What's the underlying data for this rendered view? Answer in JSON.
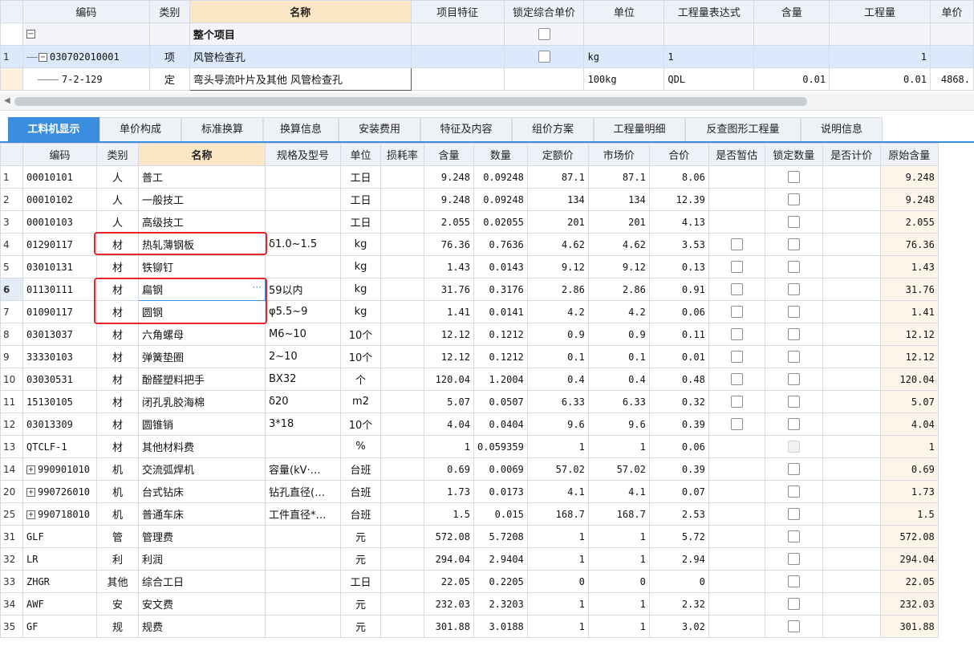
{
  "top": {
    "headers": [
      "编码",
      "类别",
      "名称",
      "项目特征",
      "锁定综合单价",
      "单位",
      "工程量表达式",
      "含量",
      "工程量",
      "单价"
    ],
    "rows": [
      {
        "idx": "",
        "tree": "−",
        "code": "",
        "type": "",
        "name": "整个项目",
        "unit": "",
        "expr": "",
        "content": "",
        "qty": "",
        "price": ""
      },
      {
        "idx": "1",
        "tree": "−",
        "code": "030702010001",
        "type": "项",
        "name": "风管检查孔",
        "unit": "kg",
        "expr": "1",
        "content": "",
        "qty": "1",
        "price": ""
      },
      {
        "idx": "",
        "tree": "",
        "code": "7-2-129",
        "type": "定",
        "name": "弯头导流叶片及其他 风管检查孔",
        "unit": "100kg",
        "expr": "QDL",
        "content": "0.01",
        "qty": "0.01",
        "price": "4868."
      }
    ]
  },
  "tabs": [
    "工料机显示",
    "单价构成",
    "标准换算",
    "换算信息",
    "安装费用",
    "特征及内容",
    "组价方案",
    "工程量明细",
    "反查图形工程量",
    "说明信息"
  ],
  "bottom": {
    "headers": [
      "编码",
      "类别",
      "名称",
      "规格及型号",
      "单位",
      "损耗率",
      "含量",
      "数量",
      "定额价",
      "市场价",
      "合价",
      "是否暂估",
      "锁定数量",
      "是否计价",
      "原始含量"
    ],
    "rows": [
      {
        "idx": "1",
        "tree": "",
        "code": "00010101",
        "type": "人",
        "name": "普工",
        "spec": "",
        "unit": "工日",
        "loss": "",
        "content": "9.248",
        "qty": "0.09248",
        "quota": "87.1",
        "market": "87.1",
        "total": "8.06",
        "est": false,
        "lock": true,
        "orig": "9.248"
      },
      {
        "idx": "2",
        "tree": "",
        "code": "00010102",
        "type": "人",
        "name": "一般技工",
        "spec": "",
        "unit": "工日",
        "loss": "",
        "content": "9.248",
        "qty": "0.09248",
        "quota": "134",
        "market": "134",
        "total": "12.39",
        "est": false,
        "lock": true,
        "orig": "9.248"
      },
      {
        "idx": "3",
        "tree": "",
        "code": "00010103",
        "type": "人",
        "name": "高级技工",
        "spec": "",
        "unit": "工日",
        "loss": "",
        "content": "2.055",
        "qty": "0.02055",
        "quota": "201",
        "market": "201",
        "total": "4.13",
        "est": false,
        "lock": true,
        "orig": "2.055"
      },
      {
        "idx": "4",
        "tree": "",
        "code": "01290117",
        "type": "材",
        "name": "热轧薄钢板",
        "spec": "δ1.0~1.5",
        "unit": "kg",
        "loss": "",
        "content": "76.36",
        "qty": "0.7636",
        "quota": "4.62",
        "market": "4.62",
        "total": "3.53",
        "est": true,
        "lock": true,
        "orig": "76.36"
      },
      {
        "idx": "5",
        "tree": "",
        "code": "03010131",
        "type": "材",
        "name": "铁铆钉",
        "spec": "",
        "unit": "kg",
        "loss": "",
        "content": "1.43",
        "qty": "0.0143",
        "quota": "9.12",
        "market": "9.12",
        "total": "0.13",
        "est": true,
        "lock": true,
        "orig": "1.43"
      },
      {
        "idx": "6",
        "tree": "",
        "code": "01130111",
        "type": "材",
        "name": "扁钢",
        "spec": "59以内",
        "unit": "kg",
        "loss": "",
        "content": "31.76",
        "qty": "0.3176",
        "quota": "2.86",
        "market": "2.86",
        "total": "0.91",
        "est": true,
        "lock": true,
        "orig": "31.76"
      },
      {
        "idx": "7",
        "tree": "",
        "code": "01090117",
        "type": "材",
        "name": "圆钢",
        "spec": "φ5.5~9",
        "unit": "kg",
        "loss": "",
        "content": "1.41",
        "qty": "0.0141",
        "quota": "4.2",
        "market": "4.2",
        "total": "0.06",
        "est": true,
        "lock": true,
        "orig": "1.41"
      },
      {
        "idx": "8",
        "tree": "",
        "code": "03013037",
        "type": "材",
        "name": "六角螺母",
        "spec": "M6~10",
        "unit": "10个",
        "loss": "",
        "content": "12.12",
        "qty": "0.1212",
        "quota": "0.9",
        "market": "0.9",
        "total": "0.11",
        "est": true,
        "lock": true,
        "orig": "12.12"
      },
      {
        "idx": "9",
        "tree": "",
        "code": "33330103",
        "type": "材",
        "name": "弹簧垫圈",
        "spec": "2~10",
        "unit": "10个",
        "loss": "",
        "content": "12.12",
        "qty": "0.1212",
        "quota": "0.1",
        "market": "0.1",
        "total": "0.01",
        "est": true,
        "lock": true,
        "orig": "12.12"
      },
      {
        "idx": "10",
        "tree": "",
        "code": "03030531",
        "type": "材",
        "name": "酚醛塑料把手",
        "spec": "BX32",
        "unit": "个",
        "loss": "",
        "content": "120.04",
        "qty": "1.2004",
        "quota": "0.4",
        "market": "0.4",
        "total": "0.48",
        "est": true,
        "lock": true,
        "orig": "120.04"
      },
      {
        "idx": "11",
        "tree": "",
        "code": "15130105",
        "type": "材",
        "name": "闭孔乳胶海棉",
        "spec": "δ20",
        "unit": "m2",
        "loss": "",
        "content": "5.07",
        "qty": "0.0507",
        "quota": "6.33",
        "market": "6.33",
        "total": "0.32",
        "est": true,
        "lock": true,
        "orig": "5.07"
      },
      {
        "idx": "12",
        "tree": "",
        "code": "03013309",
        "type": "材",
        "name": "圆锥销",
        "spec": "3*18",
        "unit": "10个",
        "loss": "",
        "content": "4.04",
        "qty": "0.0404",
        "quota": "9.6",
        "market": "9.6",
        "total": "0.39",
        "est": true,
        "lock": true,
        "orig": "4.04"
      },
      {
        "idx": "13",
        "tree": "",
        "code": "QTCLF-1",
        "type": "材",
        "name": "其他材料费",
        "spec": "",
        "unit": "%",
        "loss": "",
        "content": "1",
        "qty": "0.059359",
        "quota": "1",
        "market": "1",
        "total": "0.06",
        "est": false,
        "lock": "disabled",
        "orig": "1"
      },
      {
        "idx": "14",
        "tree": "+",
        "code": "990901010",
        "type": "机",
        "name": "交流弧焊机",
        "spec": "容量(kV·…",
        "unit": "台班",
        "loss": "",
        "content": "0.69",
        "qty": "0.0069",
        "quota": "57.02",
        "market": "57.02",
        "total": "0.39",
        "est": false,
        "lock": true,
        "orig": "0.69"
      },
      {
        "idx": "20",
        "tree": "+",
        "code": "990726010",
        "type": "机",
        "name": "台式钻床",
        "spec": "钻孔直径(…",
        "unit": "台班",
        "loss": "",
        "content": "1.73",
        "qty": "0.0173",
        "quota": "4.1",
        "market": "4.1",
        "total": "0.07",
        "est": false,
        "lock": true,
        "orig": "1.73"
      },
      {
        "idx": "25",
        "tree": "+",
        "code": "990718010",
        "type": "机",
        "name": "普通车床",
        "spec": "工件直径*…",
        "unit": "台班",
        "loss": "",
        "content": "1.5",
        "qty": "0.015",
        "quota": "168.7",
        "market": "168.7",
        "total": "2.53",
        "est": false,
        "lock": true,
        "orig": "1.5"
      },
      {
        "idx": "31",
        "tree": "",
        "code": "GLF",
        "type": "管",
        "name": "管理费",
        "spec": "",
        "unit": "元",
        "loss": "",
        "content": "572.08",
        "qty": "5.7208",
        "quota": "1",
        "market": "1",
        "total": "5.72",
        "est": false,
        "lock": true,
        "orig": "572.08"
      },
      {
        "idx": "32",
        "tree": "",
        "code": "LR",
        "type": "利",
        "name": "利润",
        "spec": "",
        "unit": "元",
        "loss": "",
        "content": "294.04",
        "qty": "2.9404",
        "quota": "1",
        "market": "1",
        "total": "2.94",
        "est": false,
        "lock": true,
        "orig": "294.04"
      },
      {
        "idx": "33",
        "tree": "",
        "code": "ZHGR",
        "type": "其他",
        "name": "综合工日",
        "spec": "",
        "unit": "工日",
        "loss": "",
        "content": "22.05",
        "qty": "0.2205",
        "quota": "0",
        "market": "0",
        "total": "0",
        "est": false,
        "lock": true,
        "orig": "22.05"
      },
      {
        "idx": "34",
        "tree": "",
        "code": "AWF",
        "type": "安",
        "name": "安文费",
        "spec": "",
        "unit": "元",
        "loss": "",
        "content": "232.03",
        "qty": "2.3203",
        "quota": "1",
        "market": "1",
        "total": "2.32",
        "est": false,
        "lock": true,
        "orig": "232.03"
      },
      {
        "idx": "35",
        "tree": "",
        "code": "GF",
        "type": "规",
        "name": "规费",
        "spec": "",
        "unit": "元",
        "loss": "",
        "content": "301.88",
        "qty": "3.0188",
        "quota": "1",
        "market": "1",
        "total": "3.02",
        "est": false,
        "lock": true,
        "orig": "301.88"
      }
    ]
  },
  "ellipsis": "···",
  "colors": {
    "accent": "#3b8de0",
    "highlight": "#e62626",
    "header": "#eef2f8",
    "name_header": "#fbe7c6"
  }
}
